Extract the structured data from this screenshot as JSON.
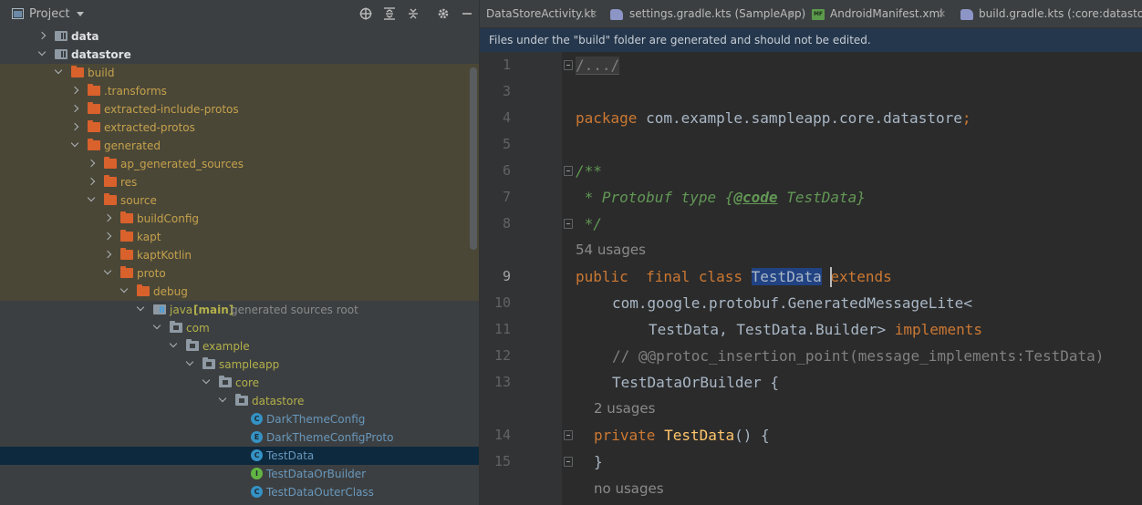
{
  "project_panel": {
    "title": "Project",
    "header_icons": [
      "crosshair-icon",
      "expand-all-icon",
      "collapse-all-icon",
      "gear-icon",
      "minimize-icon"
    ],
    "tree": [
      {
        "label": "data",
        "depth": 0,
        "arrow": "right",
        "icon": "module",
        "style": "white"
      },
      {
        "label": "datastore",
        "depth": 0,
        "arrow": "down",
        "icon": "module",
        "style": "white"
      },
      {
        "label": "build",
        "depth": 1,
        "arrow": "down",
        "icon": "orange",
        "style": "orange",
        "hl": true
      },
      {
        "label": ".transforms",
        "depth": 2,
        "arrow": "right",
        "icon": "orange",
        "style": "orange",
        "hl": true
      },
      {
        "label": "extracted-include-protos",
        "depth": 2,
        "arrow": "right",
        "icon": "orange",
        "style": "orange",
        "hl": true
      },
      {
        "label": "extracted-protos",
        "depth": 2,
        "arrow": "right",
        "icon": "orange",
        "style": "orange",
        "hl": true
      },
      {
        "label": "generated",
        "depth": 2,
        "arrow": "down",
        "icon": "orange",
        "style": "orange",
        "hl": true
      },
      {
        "label": "ap_generated_sources",
        "depth": 3,
        "arrow": "right",
        "icon": "orange",
        "style": "orange",
        "hl": true
      },
      {
        "label": "res",
        "depth": 3,
        "arrow": "right",
        "icon": "orange",
        "style": "orange",
        "hl": true
      },
      {
        "label": "source",
        "depth": 3,
        "arrow": "down",
        "icon": "orange",
        "style": "orange",
        "hl": true
      },
      {
        "label": "buildConfig",
        "depth": 4,
        "arrow": "right",
        "icon": "orange",
        "style": "orange",
        "hl": true
      },
      {
        "label": "kapt",
        "depth": 4,
        "arrow": "right",
        "icon": "orange",
        "style": "orange",
        "hl": true
      },
      {
        "label": "kaptKotlin",
        "depth": 4,
        "arrow": "right",
        "icon": "orange",
        "style": "orange",
        "hl": true
      },
      {
        "label": "proto",
        "depth": 4,
        "arrow": "down",
        "icon": "orange",
        "style": "orange",
        "hl": true
      },
      {
        "label": "debug",
        "depth": 5,
        "arrow": "down",
        "icon": "orange",
        "style": "orange",
        "hl": true
      },
      {
        "label": "java",
        "depth": 6,
        "arrow": "down",
        "icon": "srcroot",
        "style": "olive",
        "extra_mark": "[main]",
        "extra_note": "generated sources root"
      },
      {
        "label": "com",
        "depth": 7,
        "arrow": "down",
        "icon": "grey",
        "style": "olive"
      },
      {
        "label": "example",
        "depth": 8,
        "arrow": "down",
        "icon": "grey",
        "style": "olive"
      },
      {
        "label": "sampleapp",
        "depth": 9,
        "arrow": "down",
        "icon": "grey",
        "style": "olive"
      },
      {
        "label": "core",
        "depth": 10,
        "arrow": "down",
        "icon": "grey",
        "style": "olive"
      },
      {
        "label": "datastore",
        "depth": 11,
        "arrow": "down",
        "icon": "grey",
        "style": "olive"
      },
      {
        "label": "DarkThemeConfig",
        "depth": 12,
        "arrow": "none",
        "icon": "class-c",
        "style": "blue"
      },
      {
        "label": "DarkThemeConfigProto",
        "depth": 12,
        "arrow": "none",
        "icon": "class-e",
        "style": "blue"
      },
      {
        "label": "TestData",
        "depth": 12,
        "arrow": "none",
        "icon": "class-c",
        "style": "blue",
        "selected": true
      },
      {
        "label": "TestDataOrBuilder",
        "depth": 12,
        "arrow": "none",
        "icon": "class-i",
        "style": "blue"
      },
      {
        "label": "TestDataOuterClass",
        "depth": 12,
        "arrow": "none",
        "icon": "class-c",
        "style": "blue"
      }
    ]
  },
  "tabs": [
    {
      "label": "DataStoreActivity.kt",
      "icon": "none"
    },
    {
      "label": "settings.gradle.kts (SampleApp)",
      "icon": "gradle"
    },
    {
      "label": "AndroidManifest.xml",
      "icon": "manifest"
    },
    {
      "label": "build.gradle.kts (:core:datastore)",
      "icon": "gradle"
    }
  ],
  "banner": "Files under the \"build\" folder are generated and should not be edited.",
  "editor": {
    "line_numbers": [
      "1",
      "3",
      "4",
      "5",
      "6",
      "7",
      "8",
      "9",
      "10",
      "11",
      "12",
      "13",
      "14",
      "15"
    ],
    "current_line": "9",
    "hints": [
      "54 usages",
      "2 usages",
      "no usages"
    ],
    "code": {
      "l1": "/.../",
      "l4_kw": "package",
      "l4_rest": " com.example.sampleapp.core.datastore",
      "l4_semi": ";",
      "l6": "/**",
      "l7_a": " * Protobuf type {",
      "l7_tag": "@code",
      "l7_b": " TestData}",
      "l8": " */",
      "l9_kw1": "public  final class ",
      "l9_cls": "TestData",
      "l9_kw2": " extends",
      "l10": "com.google.protobuf.GeneratedMessageLite<",
      "l11_a": "TestData, TestData.Builder> ",
      "l11_kw": "implements",
      "l12": "// @@protoc_insertion_point(message_implements:TestData)",
      "l13": "TestDataOrBuilder {",
      "l14_kw": "private ",
      "l14_fn": "TestData",
      "l14_rest": "() {",
      "l15": "}"
    }
  }
}
